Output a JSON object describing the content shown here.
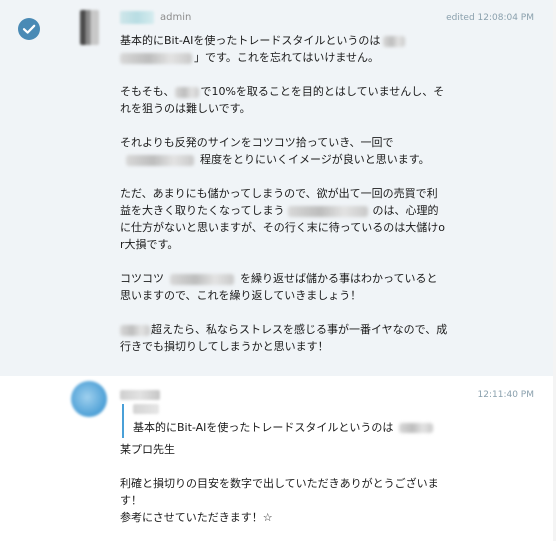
{
  "admin_message": {
    "role": "admin",
    "timestamp": "edited 12:08:04 PM",
    "paragraphs": [
      {
        "pre": "基本的にBit-AIを使ったトレードスタイルというのは",
        "post": "」です。これを忘れてはいけません。"
      },
      {
        "pre": "そもそも、",
        "post": "で10%を取ることを目的とはしていませんし、それを狙うのは難しいです。"
      },
      {
        "pre": "それよりも反発のサインをコツコツ拾っていき、一回で",
        "post": "程度をとりにいくイメージが良いと思います。"
      },
      {
        "pre": "ただ、あまりにも儲かってしまうので、欲が出て一回の売買で利益を大きく取りたくなってしまう",
        "post": "のは、心理的に仕方がないと思いますが、その行く末に待っているのは大儲けor大損です。"
      },
      {
        "pre": "コツコツ",
        "post": "を繰り返せば儲かる事はわかっていると思いますので、これを繰り返していきましょう！"
      },
      {
        "pre": "",
        "post": "超えたら、私ならストレスを感じる事が一番イヤなので、成行きでも損切りしてしまうかと思います！"
      }
    ]
  },
  "user_message": {
    "timestamp": "12:11:40 PM",
    "quote_text": "基本的にBit-AIを使ったトレードスタイルというのは",
    "lines": [
      "某プロ先生",
      "利確と損切りの目安を数字で出していただきありがとうございます！",
      "参考にさせていただきます！☆"
    ]
  }
}
